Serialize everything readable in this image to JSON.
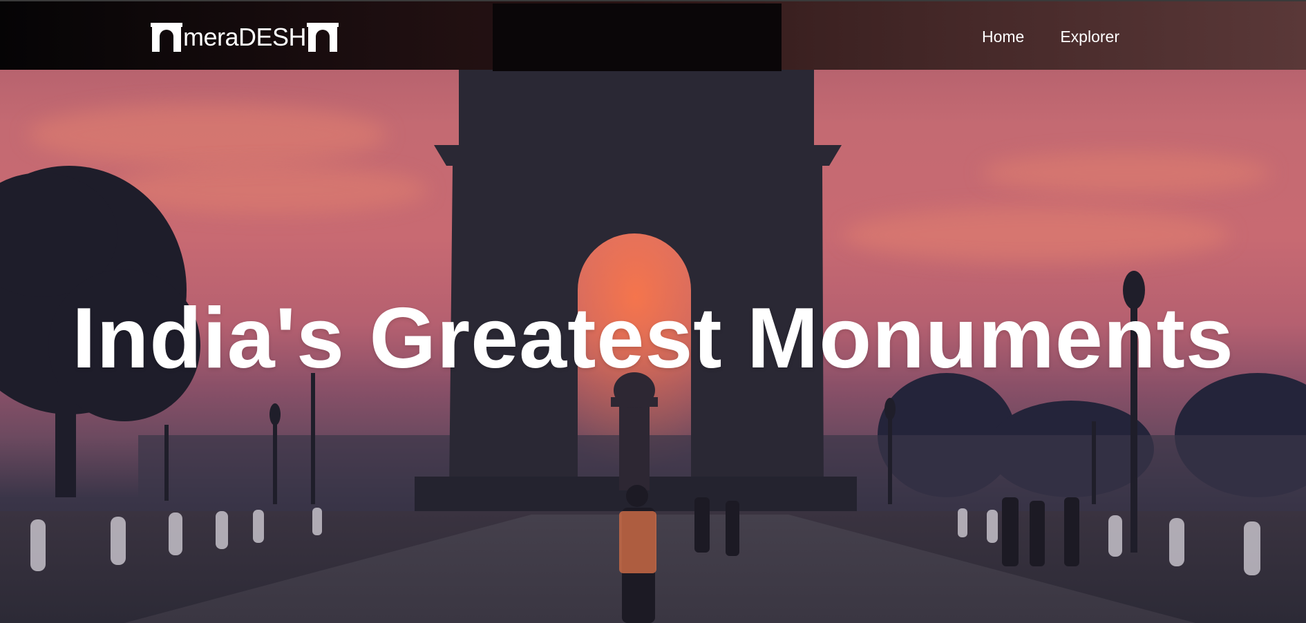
{
  "navbar": {
    "brand": {
      "text": "meraDESH",
      "logo_icon": "india-gate-icon"
    },
    "links": [
      {
        "label": "Home"
      },
      {
        "label": "Explorer"
      }
    ]
  },
  "hero": {
    "title": "India's Greatest Monuments",
    "background": "india-gate-sunset-photo"
  },
  "colors": {
    "navbar_left": "#050405",
    "navbar_right": "#5a3838",
    "sky_top": "#a85a6a",
    "sky_glow": "#ff7846",
    "text": "#ffffff"
  }
}
